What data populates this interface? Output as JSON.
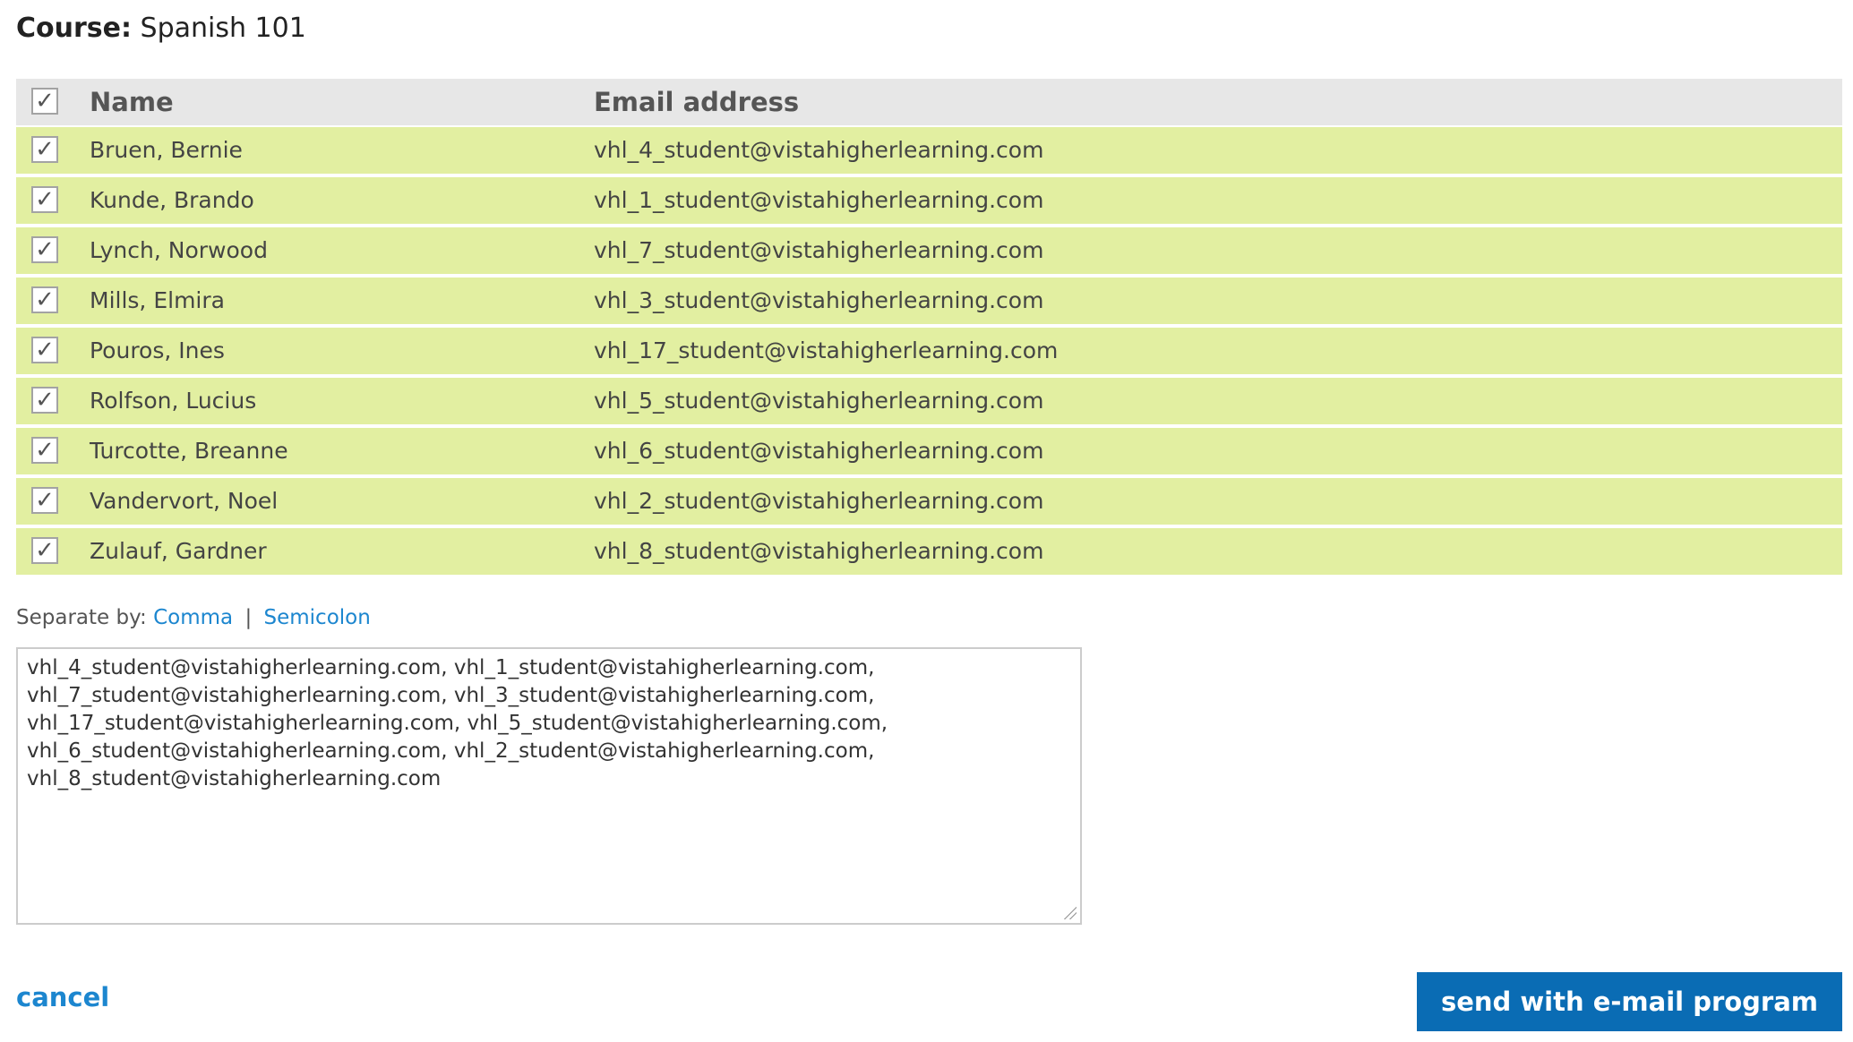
{
  "course": {
    "label": "Course:",
    "value": "Spanish 101"
  },
  "table": {
    "header_check": "✓",
    "col_name": "Name",
    "col_email": "Email address",
    "rows": [
      {
        "name": "Bruen, Bernie",
        "email": "vhl_4_student@vistahigherlearning.com",
        "checked": "✓"
      },
      {
        "name": "Kunde, Brando",
        "email": "vhl_1_student@vistahigherlearning.com",
        "checked": "✓"
      },
      {
        "name": "Lynch, Norwood",
        "email": "vhl_7_student@vistahigherlearning.com",
        "checked": "✓"
      },
      {
        "name": "Mills, Elmira",
        "email": "vhl_3_student@vistahigherlearning.com",
        "checked": "✓"
      },
      {
        "name": "Pouros, Ines",
        "email": "vhl_17_student@vistahigherlearning.com",
        "checked": "✓"
      },
      {
        "name": "Rolfson, Lucius",
        "email": "vhl_5_student@vistahigherlearning.com",
        "checked": "✓"
      },
      {
        "name": "Turcotte, Breanne",
        "email": "vhl_6_student@vistahigherlearning.com",
        "checked": "✓"
      },
      {
        "name": "Vandervort, Noel",
        "email": "vhl_2_student@vistahigherlearning.com",
        "checked": "✓"
      },
      {
        "name": "Zulauf, Gardner",
        "email": "vhl_8_student@vistahigherlearning.com",
        "checked": "✓"
      }
    ]
  },
  "separator": {
    "label": "Separate by:",
    "comma": "Comma",
    "pipe": "|",
    "semicolon": "Semicolon"
  },
  "emails_text": "vhl_4_student@vistahigherlearning.com, vhl_1_student@vistahigherlearning.com,\nvhl_7_student@vistahigherlearning.com, vhl_3_student@vistahigherlearning.com,\nvhl_17_student@vistahigherlearning.com, vhl_5_student@vistahigherlearning.com,\nvhl_6_student@vistahigherlearning.com, vhl_2_student@vistahigherlearning.com,\nvhl_8_student@vistahigherlearning.com",
  "actions": {
    "cancel": "cancel",
    "send": "send with e-mail program"
  },
  "colors": {
    "row_selected": "#e2efa1",
    "header_bg": "#e7e7e7",
    "link": "#1c86cf",
    "button_bg": "#0a6cb4"
  }
}
